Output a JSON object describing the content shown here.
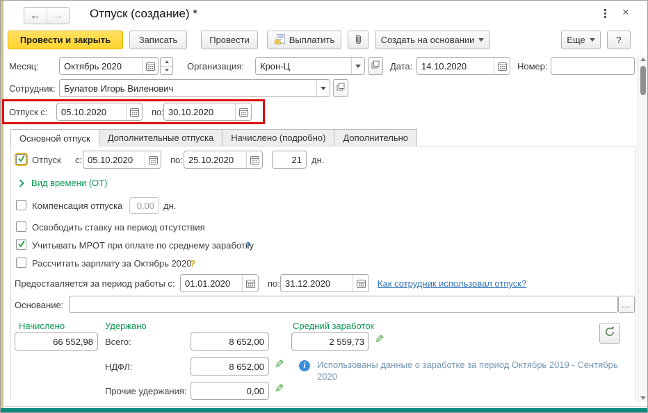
{
  "window": {
    "title": "Отпуск (создание) *"
  },
  "glyphs": {
    "back": "←",
    "forward": "→",
    "close": "×"
  },
  "toolbar": {
    "post_and_close": "Провести и закрыть",
    "write": "Записать",
    "post": "Провести",
    "pay": "Выплатить",
    "create_based_on": "Создать на основании",
    "more": "Еще",
    "help": "?"
  },
  "fields": {
    "month": {
      "label": "Месяц:",
      "value": "Октябрь 2020"
    },
    "organization": {
      "label": "Организация:",
      "value": "Крон-Ц"
    },
    "date": {
      "label": "Дата:",
      "value": "14.10.2020"
    },
    "number": {
      "label": "Номер:",
      "value": ""
    },
    "employee": {
      "label": "Сотрудник:",
      "value": "Булатов Игорь Виленович"
    },
    "vacation_from": {
      "label": "Отпуск с:",
      "value": "05.10.2020"
    },
    "vacation_to": {
      "label": "по:",
      "value": "30.10.2020"
    }
  },
  "tabs": [
    {
      "label": "Основной отпуск"
    },
    {
      "label": "Дополнительные отпуска"
    },
    {
      "label": "Начислено (подробно)"
    },
    {
      "label": "Дополнительно"
    }
  ],
  "main_tab": {
    "vacation": {
      "label": "Отпуск",
      "from_label": "с:",
      "from": "05.10.2020",
      "to_label": "по:",
      "to": "25.10.2020",
      "days": "21",
      "days_unit": "дн."
    },
    "time_type_link": "Вид времени (ОТ)",
    "compensation": {
      "label": "Компенсация отпуска",
      "value": "0,00",
      "unit": "дн."
    },
    "release_rate_label": "Освободить ставку на период отсутствия",
    "mrot_label": "Учитывать МРОТ при оплате по среднему заработку",
    "mrot_help": "?",
    "calc_salary_label": "Рассчитать зарплату за Октябрь 2020",
    "calc_salary_help": "?",
    "work_period": {
      "label": "Предоставляется за период работы с:",
      "from": "01.01.2020",
      "to_label": "по:",
      "to": "31.12.2020"
    },
    "usage_link": "Как сотрудник использовал отпуск?",
    "basis": {
      "label": "Основание:",
      "value": "",
      "more": "..."
    }
  },
  "totals": {
    "accrued": {
      "header": "Начислено",
      "value": "66 552,98"
    },
    "withheld": {
      "header": "Удержано",
      "total_label": "Всего:",
      "total": "8 652,00",
      "ndfl_label": "НДФЛ:",
      "ndfl": "8 652,00",
      "other_label": "Прочие удержания:",
      "other": "0,00"
    },
    "average": {
      "header": "Средний заработок",
      "value": "2 559,73"
    },
    "info_message": "Использованы данные о заработке за период Октябрь 2019 - Сентябрь 2020"
  },
  "colors": {
    "primary_button": "#ffd93b",
    "green": "#0a9950",
    "link": "#2d71b8",
    "annotation_red": "#dd0c0c",
    "bottom_bar": "#0f8a7e",
    "info_text": "#7597b5"
  }
}
